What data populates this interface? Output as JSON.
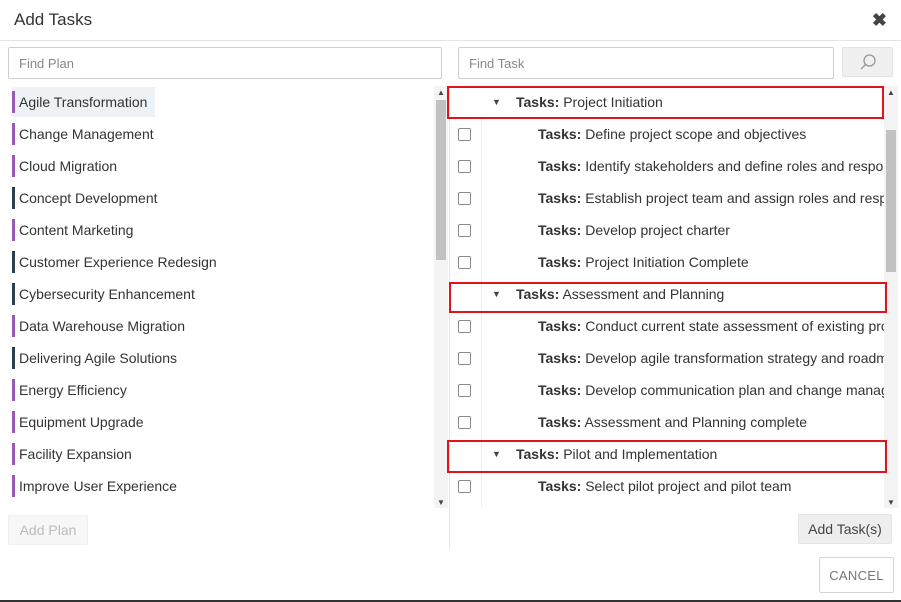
{
  "dialog": {
    "title": "Add Tasks",
    "close_glyph": "✖",
    "cancel_label": "CANCEL"
  },
  "plans": {
    "search_placeholder": "Find Plan",
    "add_label": "Add Plan",
    "items": [
      {
        "label": "Agile Transformation",
        "color": "#9b59b6"
      },
      {
        "label": "Change Management",
        "color": "#9b59b6"
      },
      {
        "label": "Cloud Migration",
        "color": "#9b59b6"
      },
      {
        "label": "Concept Development",
        "color": "#2c3e50"
      },
      {
        "label": "Content Marketing",
        "color": "#9b59b6"
      },
      {
        "label": "Customer Experience Redesign",
        "color": "#2c3e50"
      },
      {
        "label": "Cybersecurity Enhancement",
        "color": "#2c3e50"
      },
      {
        "label": "Data Warehouse Migration",
        "color": "#9b59b6"
      },
      {
        "label": "Delivering Agile Solutions",
        "color": "#2c3e50"
      },
      {
        "label": "Energy Efficiency",
        "color": "#9b59b6"
      },
      {
        "label": "Equipment Upgrade",
        "color": "#9b59b6"
      },
      {
        "label": "Facility Expansion",
        "color": "#9b59b6"
      },
      {
        "label": "Improve User Experience",
        "color": "#9b59b6"
      }
    ]
  },
  "tasks": {
    "search_placeholder": "Find Task",
    "search_icon": "search-icon",
    "add_label": "Add Task(s)",
    "prefix": "Tasks:",
    "rows": [
      {
        "type": "group",
        "name": " Project Initiation"
      },
      {
        "type": "task",
        "name": " Define project scope and objectives"
      },
      {
        "type": "task",
        "name": " Identify stakeholders and define roles and respor"
      },
      {
        "type": "task",
        "name": " Establish project team and assign roles and respo"
      },
      {
        "type": "task",
        "name": " Develop project charter"
      },
      {
        "type": "task",
        "name": " Project Initiation Complete"
      },
      {
        "type": "group",
        "name": " Assessment and Planning"
      },
      {
        "type": "task",
        "name": " Conduct current state assessment of existing proc"
      },
      {
        "type": "task",
        "name": " Develop agile transformation strategy and roadm"
      },
      {
        "type": "task",
        "name": " Develop communication plan and change manag"
      },
      {
        "type": "task",
        "name": " Assessment and Planning complete"
      },
      {
        "type": "group",
        "name": " Pilot and Implementation"
      },
      {
        "type": "task",
        "name": " Select pilot project and pilot team"
      }
    ]
  },
  "colors": {
    "highlight": "#e0121c",
    "purple_bar": "#9b59b6",
    "navy_bar": "#2c3e50"
  }
}
